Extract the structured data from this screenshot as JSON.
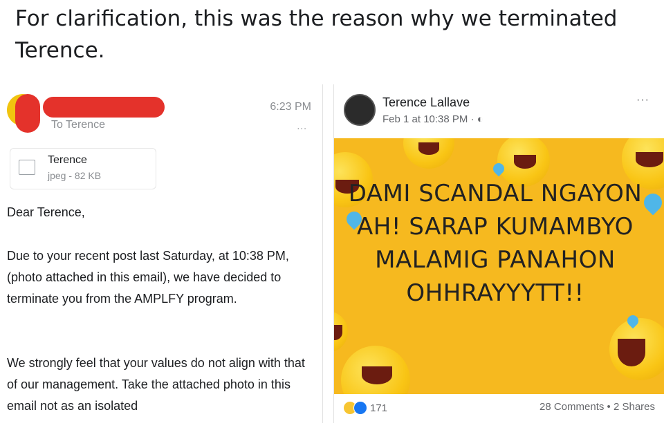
{
  "caption": "For clarification, this was the reason why we terminated Terence.",
  "email": {
    "time": "6:23 PM",
    "to": "To Terence",
    "more": "...",
    "attachment": {
      "name": "Terence",
      "meta": "jpeg - 82 KB"
    },
    "greeting": "Dear Terence,",
    "paragraph1": "Due to your recent post last Saturday, at 10:38 PM, (photo attached in this email), we have decided to terminate you from the AMPLFY program.",
    "paragraph2": "We strongly feel that your values do not align with that of our management. Take the attached photo in this email not as an isolated",
    "colors": {
      "redaction": "#e4322b",
      "avatar": "#f1c40f"
    }
  },
  "post": {
    "author": "Terence Lallave",
    "date": "Feb 1 at 10:38 PM · ",
    "more": "···",
    "meme_text": "DAMI SCANDAL NGAYON AH! SARAP KUMAMBYO MALAMIG PANAHON OHHRAYYYTT!!",
    "reaction_count": "171",
    "comments_shares": "28 Comments • 2 Shares",
    "colors": {
      "meme_background": "#f6b91f",
      "like_blue": "#1877f2"
    }
  }
}
